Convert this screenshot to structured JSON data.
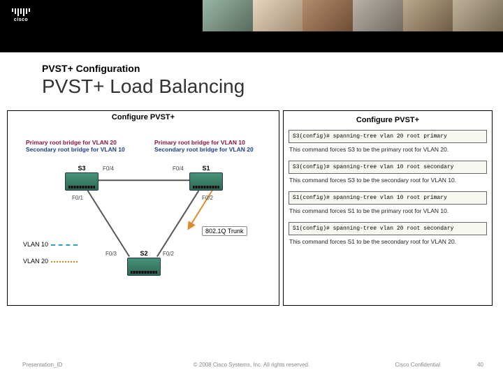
{
  "header": {
    "logo_text": "cisco"
  },
  "titles": {
    "subtitle": "PVST+ Configuration",
    "title": "PVST+ Load Balancing"
  },
  "left_panel": {
    "title": "Configure PVST+",
    "note_s3_primary": "Primary root bridge for VLAN 20",
    "note_s3_secondary": "Secondary root bridge for VLAN 10",
    "note_s1_primary": "Primary root bridge for VLAN 10",
    "note_s1_secondary": "Secondary root bridge for VLAN 20",
    "s3": "S3",
    "s1": "S1",
    "s2": "S2",
    "ports": {
      "s3_f04": "F0/4",
      "s1_f04": "F0/4",
      "s3_f01": "F0/1",
      "s1_f02": "F0/2",
      "s2_f03": "F0/3",
      "s2_f02": "F0/2"
    },
    "vlan10": "VLAN 10",
    "vlan20": "VLAN 20",
    "trunk": "802.1Q Trunk"
  },
  "right_panel": {
    "title": "Configure PVST+",
    "blocks": [
      {
        "cmd": "S3(config)# spanning-tree vlan 20 root primary",
        "desc": "This command forces S3 to be the primary root for VLAN 20."
      },
      {
        "cmd": "S3(config)# spanning-tree vlan 10 root secondary",
        "desc": "This command forces S3 to be the secondary root for VLAN 10."
      },
      {
        "cmd": "S1(config)# spanning-tree vlan 10 root primary",
        "desc": "This command forces S1 to be the primary root for VLAN 10."
      },
      {
        "cmd": "S1(config)# spanning-tree vlan 20 root secondary",
        "desc": "This command forces S1 to be the secondary root for VLAN 20."
      }
    ]
  },
  "footer": {
    "left": "Presentation_ID",
    "center": "© 2008 Cisco Systems, Inc. All rights reserved.",
    "confidential": "Cisco Confidential",
    "page": "40"
  }
}
